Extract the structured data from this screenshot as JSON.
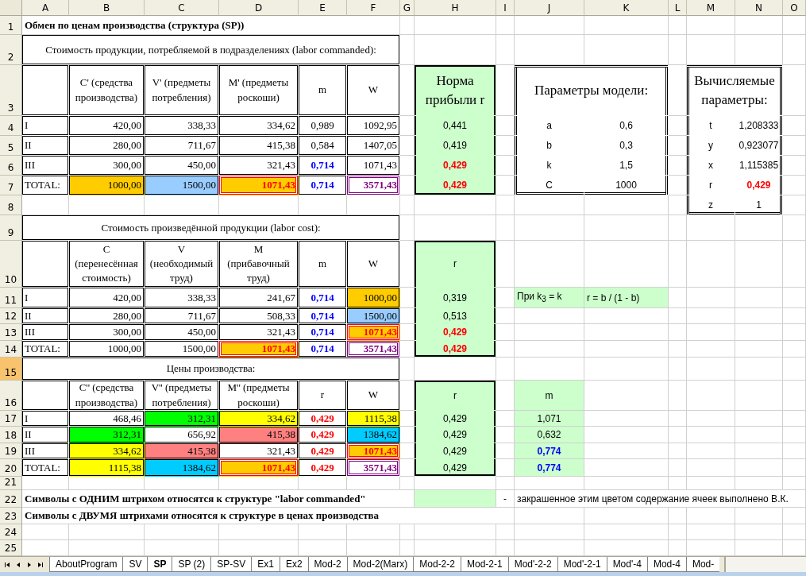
{
  "columns": [
    "A",
    "B",
    "C",
    "D",
    "E",
    "F",
    "G",
    "H",
    "I",
    "J",
    "K",
    "L",
    "M",
    "N",
    "O"
  ],
  "rows": [
    {
      "number": "1",
      "selected": false,
      "cells": [
        {
          "text": "Обмен по ценам производства (структура (SP))",
          "bold": true
        }
      ]
    },
    {
      "number": "2",
      "selected": false,
      "cells": [
        {
          "text": "Стоимость продукции, потребляемой в подразделениях (labor commanded):"
        }
      ]
    },
    {
      "number": "3",
      "selected": false,
      "cells": [
        {
          "text": "C' (средства производства)"
        },
        {
          "text": "V' (предметы потребления)"
        },
        {
          "text": "M' (предметы роскоши)"
        },
        {
          "text": "m"
        },
        {
          "text": "W"
        },
        {
          "text": "Норма прибыли r",
          "fill": {
            "color": "#ccffcc"
          }
        },
        {
          "text": "Параметры модели:"
        },
        {
          "text": "Вычисляемые параметры:"
        }
      ]
    },
    {
      "number": "4",
      "selected": false,
      "cells": [
        {
          "text": "I"
        },
        {
          "text": "420,00"
        },
        {
          "text": "338,33"
        },
        {
          "text": "334,62"
        },
        {
          "text": "0,989"
        },
        {
          "text": "1092,95"
        },
        {
          "text": "0,441",
          "fill": {
            "color": "#ccffcc"
          }
        },
        {
          "text": "a"
        },
        {
          "text": "0,6"
        },
        {
          "text": "t"
        },
        {
          "text": "1,208333"
        }
      ]
    },
    {
      "number": "5",
      "selected": false,
      "cells": [
        {
          "text": "II"
        },
        {
          "text": "280,00"
        },
        {
          "text": "711,67"
        },
        {
          "text": "415,38"
        },
        {
          "text": "0,584"
        },
        {
          "text": "1407,05"
        },
        {
          "text": "0,419",
          "fill": {
            "color": "#ccffcc"
          }
        },
        {
          "text": "b"
        },
        {
          "text": "0,3"
        },
        {
          "text": "y"
        },
        {
          "text": "0,923077"
        }
      ]
    },
    {
      "number": "6",
      "selected": false,
      "cells": [
        {
          "text": "III"
        },
        {
          "text": "300,00"
        },
        {
          "text": "450,00"
        },
        {
          "text": "321,43"
        },
        {
          "text": "0,714",
          "bold": true,
          "font": {
            "color": "#0000ff"
          }
        },
        {
          "text": "1071,43"
        },
        {
          "text": "0,429",
          "bold": true,
          "font": {
            "color": "#ff0000"
          },
          "fill": {
            "color": "#ccffcc"
          }
        },
        {
          "text": "k"
        },
        {
          "text": "1,5"
        },
        {
          "text": "x"
        },
        {
          "text": "1,115385"
        }
      ]
    },
    {
      "number": "7",
      "selected": false,
      "cells": [
        {
          "text": "TOTAL:"
        },
        {
          "text": "1000,00",
          "fill": {
            "color": "#ffcc00"
          }
        },
        {
          "text": "1500,00",
          "fill": {
            "color": "#99ccff"
          }
        },
        {
          "text": "1071,43",
          "bold": true,
          "font": {
            "color": "#ff0000"
          },
          "fill": {
            "color": "#ffcc00"
          },
          "border": {
            "color": "#ff0000"
          }
        },
        {
          "text": "0,714",
          "bold": true,
          "font": {
            "color": "#0000ff"
          }
        },
        {
          "text": "3571,43",
          "bold": true,
          "font": {
            "color": "#800080"
          },
          "border": {
            "color": "#800080"
          }
        },
        {
          "text": "0,429",
          "bold": true,
          "font": {
            "color": "#ff0000"
          },
          "fill": {
            "color": "#ccffcc"
          }
        },
        {
          "text": "C"
        },
        {
          "text": "1000"
        },
        {
          "text": "r"
        },
        {
          "text": "0,429",
          "bold": true,
          "font": {
            "color": "#ff0000"
          }
        }
      ]
    },
    {
      "number": "8",
      "selected": false,
      "cells": [
        {
          "text": "z"
        },
        {
          "text": "1"
        }
      ]
    },
    {
      "number": "9",
      "selected": false,
      "cells": [
        {
          "text": "Стоимость произведённой продукции (labor cost):"
        }
      ]
    },
    {
      "number": "10",
      "selected": false,
      "cells": [
        {
          "text": "C (перенесённая стоимость)"
        },
        {
          "text": "V (необходимый труд)"
        },
        {
          "text": "M (прибавочный труд)"
        },
        {
          "text": "m"
        },
        {
          "text": "W"
        },
        {
          "text": "r",
          "fill": {
            "color": "#ccffcc"
          }
        }
      ]
    },
    {
      "number": "11",
      "selected": false,
      "cells": [
        {
          "text": "I"
        },
        {
          "text": "420,00"
        },
        {
          "text": "338,33"
        },
        {
          "text": "241,67"
        },
        {
          "text": "0,714",
          "bold": true,
          "font": {
            "color": "#0000ff"
          }
        },
        {
          "text": "1000,00",
          "fill": {
            "color": "#ffcc00"
          }
        },
        {
          "text": "0,319",
          "fill": {
            "color": "#ccffcc"
          }
        },
        {
          "text": "При k$_{3}$ = k",
          "fill": {
            "color": "#ccffcc"
          }
        },
        {
          "text": "r = b / (1 - b)",
          "fill": {
            "color": "#ccffcc"
          }
        }
      ]
    },
    {
      "number": "12",
      "selected": false,
      "cells": [
        {
          "text": "II"
        },
        {
          "text": "280,00"
        },
        {
          "text": "711,67"
        },
        {
          "text": "508,33"
        },
        {
          "text": "0,714",
          "bold": true,
          "font": {
            "color": "#0000ff"
          }
        },
        {
          "text": "1500,00",
          "fill": {
            "color": "#99ccff"
          }
        },
        {
          "text": "0,513",
          "fill": {
            "color": "#ccffcc"
          }
        }
      ]
    },
    {
      "number": "13",
      "selected": false,
      "cells": [
        {
          "text": "III"
        },
        {
          "text": "300,00"
        },
        {
          "text": "450,00"
        },
        {
          "text": "321,43"
        },
        {
          "text": "0,714",
          "bold": true,
          "font": {
            "color": "#0000ff"
          }
        },
        {
          "text": "1071,43",
          "bold": true,
          "font": {
            "color": "#ff0000"
          },
          "fill": {
            "color": "#ffcc00"
          },
          "border": {
            "color": "#ff0000"
          }
        },
        {
          "text": "0,429",
          "bold": true,
          "font": {
            "color": "#ff0000"
          },
          "fill": {
            "color": "#ccffcc"
          }
        }
      ]
    },
    {
      "number": "14",
      "selected": false,
      "cells": [
        {
          "text": "TOTAL:"
        },
        {
          "text": "1000,00"
        },
        {
          "text": "1500,00"
        },
        {
          "text": "1071,43",
          "bold": true,
          "font": {
            "color": "#ff0000"
          },
          "fill": {
            "color": "#ffcc00"
          },
          "border": {
            "color": "#ff0000"
          }
        },
        {
          "text": "0,714",
          "bold": true,
          "font": {
            "color": "#0000ff"
          }
        },
        {
          "text": "3571,43",
          "bold": true,
          "font": {
            "color": "#800080"
          },
          "border": {
            "color": "#800080"
          }
        },
        {
          "text": "0,429",
          "bold": true,
          "font": {
            "color": "#ff0000"
          },
          "fill": {
            "color": "#ccffcc"
          }
        }
      ]
    },
    {
      "number": "15",
      "selected": true,
      "cells": [
        {
          "text": "Цены производства:"
        }
      ]
    },
    {
      "number": "16",
      "selected": false,
      "cells": [
        {
          "text": "C'' (средства производства)"
        },
        {
          "text": "V'' (предметы потребления)"
        },
        {
          "text": "M'' (предметы роскоши)"
        },
        {
          "text": "r"
        },
        {
          "text": "W"
        },
        {
          "text": "r",
          "fill": {
            "color": "#ccffcc"
          }
        },
        {
          "text": "m",
          "fill": {
            "color": "#ccffcc"
          }
        }
      ]
    },
    {
      "number": "17",
      "selected": false,
      "cells": [
        {
          "text": "I"
        },
        {
          "text": "468,46"
        },
        {
          "text": "312,31",
          "fill": {
            "color": "#00ff00"
          }
        },
        {
          "text": "334,62",
          "fill": {
            "color": "#ffff00"
          }
        },
        {
          "text": "0,429",
          "bold": true,
          "font": {
            "color": "#ff0000"
          }
        },
        {
          "text": "1115,38",
          "fill": {
            "color": "#ffff00"
          }
        },
        {
          "text": "0,429",
          "fill": {
            "color": "#ccffcc"
          }
        },
        {
          "text": "1,071",
          "fill": {
            "color": "#ccffcc"
          }
        }
      ]
    },
    {
      "number": "18",
      "selected": false,
      "cells": [
        {
          "text": "II"
        },
        {
          "text": "312,31",
          "fill": {
            "color": "#00ff00"
          }
        },
        {
          "text": "656,92"
        },
        {
          "text": "415,38",
          "fill": {
            "color": "#ff8080"
          }
        },
        {
          "text": "0,429",
          "bold": true,
          "font": {
            "color": "#ff0000"
          }
        },
        {
          "text": "1384,62",
          "fill": {
            "color": "#00ccff"
          }
        },
        {
          "text": "0,429",
          "fill": {
            "color": "#ccffcc"
          }
        },
        {
          "text": "0,632",
          "fill": {
            "color": "#ccffcc"
          }
        }
      ]
    },
    {
      "number": "19",
      "selected": false,
      "cells": [
        {
          "text": "III"
        },
        {
          "text": "334,62",
          "fill": {
            "color": "#ffff00"
          }
        },
        {
          "text": "415,38",
          "fill": {
            "color": "#ff8080"
          }
        },
        {
          "text": "321,43"
        },
        {
          "text": "0,429",
          "bold": true,
          "font": {
            "color": "#ff0000"
          }
        },
        {
          "text": "1071,43",
          "bold": true,
          "font": {
            "color": "#ff0000"
          },
          "fill": {
            "color": "#ffcc00"
          },
          "border": {
            "color": "#ff0000"
          }
        },
        {
          "text": "0,429",
          "fill": {
            "color": "#ccffcc"
          }
        },
        {
          "text": "0,774",
          "bold": true,
          "font": {
            "color": "#0000ff"
          },
          "fill": {
            "color": "#ccffcc"
          }
        }
      ]
    },
    {
      "number": "20",
      "selected": false,
      "cells": [
        {
          "text": "TOTAL:"
        },
        {
          "text": "1115,38",
          "fill": {
            "color": "#ffff00"
          }
        },
        {
          "text": "1384,62",
          "fill": {
            "color": "#00ccff"
          }
        },
        {
          "text": "1071,43",
          "bold": true,
          "font": {
            "color": "#ff0000"
          },
          "fill": {
            "color": "#ffcc00"
          },
          "border": {
            "color": "#ff0000"
          }
        },
        {
          "text": "0,429",
          "bold": true,
          "font": {
            "color": "#ff0000"
          }
        },
        {
          "text": "3571,43",
          "bold": true,
          "font": {
            "color": "#800080"
          },
          "border": {
            "color": "#800080"
          }
        },
        {
          "text": "0,429",
          "fill": {
            "color": "#ccffcc"
          }
        },
        {
          "text": "0,774",
          "bold": true,
          "font": {
            "color": "#0000ff"
          },
          "fill": {
            "color": "#ccffcc"
          }
        }
      ]
    },
    {
      "number": "21",
      "selected": false,
      "cells": []
    },
    {
      "number": "22",
      "selected": false,
      "cells": [
        {
          "text": "Символы с ОДНИМ штрихом относятся к структуре \"labor commanded\"",
          "bold": true
        },
        {
          "fill": {
            "color": "#ccffcc"
          }
        },
        {
          "text": "-"
        },
        {
          "text": "закрашенное этим цветом содержание ячеек выполнено В.К."
        }
      ]
    },
    {
      "number": "23",
      "selected": false,
      "cells": [
        {
          "text": "Символы с ДВУМЯ штрихами относятся к структуре в ценах производства",
          "bold": true
        }
      ]
    },
    {
      "number": "24",
      "selected": false,
      "cells": []
    },
    {
      "number": "25",
      "selected": false,
      "cells": []
    }
  ],
  "sheet_tabs": [
    {
      "label": "AboutProgram",
      "selected": false
    },
    {
      "label": "SV",
      "selected": false
    },
    {
      "label": "SP",
      "selected": true
    },
    {
      "label": "SP (2)",
      "selected": false
    },
    {
      "label": "SP-SV",
      "selected": false
    },
    {
      "label": "Ex1",
      "selected": false
    },
    {
      "label": "Ex2",
      "selected": false
    },
    {
      "label": "Mod-2",
      "selected": false
    },
    {
      "label": "Mod-2(Marx)",
      "selected": false
    },
    {
      "label": "Mod-2-2",
      "selected": false
    },
    {
      "label": "Mod-2-1",
      "selected": false
    },
    {
      "label": "Mod'-2-2",
      "selected": false
    },
    {
      "label": "Mod'-2-1",
      "selected": false
    },
    {
      "label": "Mod'-4",
      "selected": false
    },
    {
      "label": "Mod-4",
      "selected": false
    },
    {
      "label": "Mod-",
      "selected": false
    }
  ]
}
